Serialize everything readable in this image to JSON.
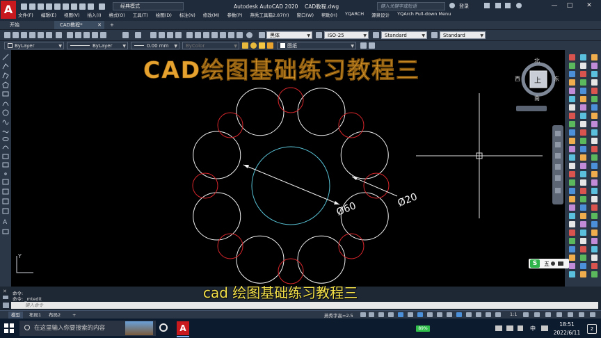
{
  "window": {
    "app_title": "Autodesk AutoCAD 2020",
    "file_name": "CAD教程.dwg",
    "workspace": "经典模式",
    "search_placeholder": "键入关键字或短语",
    "user_label": "登录",
    "win_controls": {
      "minimize": "—",
      "maximize": "□",
      "close": "✕"
    },
    "logo": "A"
  },
  "menus": [
    "文件(F)",
    "编辑(E)",
    "视图(V)",
    "插入(I)",
    "格式(O)",
    "工具(T)",
    "绘图(D)",
    "标注(N)",
    "修改(M)",
    "参数(P)",
    "燕秀工具箱2.87(Y)",
    "窗口(W)",
    "帮助(H)",
    "YQARCH",
    "源泉设计",
    "YQArch Pull-down Menu"
  ],
  "doc_tabs": {
    "start": "开始",
    "active": "CAD教程*",
    "add": "+"
  },
  "toolbar": {
    "text_style": "黑体",
    "dim_style": "ISO-25",
    "table_style": "Standard",
    "multileader_style": "Standard",
    "layer": "ByLayer",
    "linetype": "ByLayer",
    "lineweight": "0.00 mm",
    "plot_color": "ByColor",
    "layer_name": "图纸"
  },
  "drawing": {
    "dim_large": "Ø60",
    "dim_small": "Ø20",
    "colors": {
      "white": "#f2f2f2",
      "red": "#d8262b",
      "cyan": "#58c3d6"
    }
  },
  "overlay_title": "CAD绘图基础练习教程三",
  "subtitle": "cad 绘图基础练习教程三",
  "viewcube": {
    "north": "北",
    "south": "南",
    "east": "东",
    "west": "西",
    "top": "上"
  },
  "ucs": {
    "y": "Y"
  },
  "command": {
    "line1": "命令:",
    "line2": "命令: _mtedit",
    "input_placeholder": "键入命令"
  },
  "layout_tabs": {
    "model": "模型",
    "layout1": "布局1",
    "layout2": "布局2",
    "add": "+"
  },
  "status": {
    "scale_label": "燕秀字高=2.5",
    "zoom": "1:1"
  },
  "ime": {
    "label": "五"
  },
  "taskbar": {
    "search_placeholder": "在这里输入你要搜索的内容",
    "battery": "89%",
    "time": "18:51",
    "date": "2022/6/11",
    "notifications": "2",
    "ime_char": "中"
  }
}
